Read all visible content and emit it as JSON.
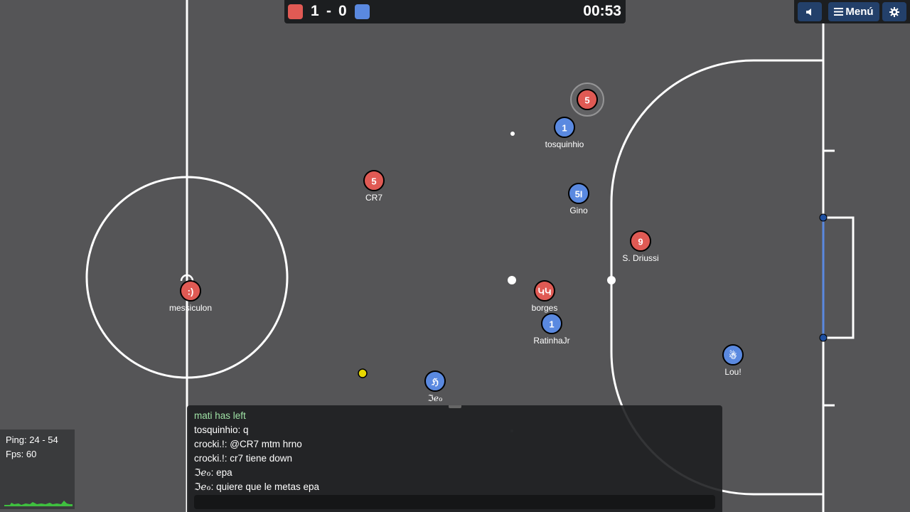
{
  "scoreboard": {
    "red_score": "1",
    "separator": "-",
    "blue_score": "0",
    "time": "00:53",
    "red_color": "#e05a54",
    "blue_color": "#5a89e0"
  },
  "controls": {
    "sound_icon": "speaker-icon",
    "menu_label": "Menú",
    "menu_icon": "hamburger-icon",
    "settings_icon": "gear-icon"
  },
  "players": [
    {
      "team": "red",
      "avatar": "5",
      "name": ""
    },
    {
      "team": "blue",
      "avatar": "1",
      "name": "tosquinhio"
    },
    {
      "team": "red",
      "avatar": "5",
      "name": "CR7"
    },
    {
      "team": "blue",
      "avatar": "5I",
      "name": "Gino"
    },
    {
      "team": "red",
      "avatar": "9",
      "name": "S. Driussi"
    },
    {
      "team": "red",
      "avatar": ":)",
      "name": "messiculon"
    },
    {
      "team": "red",
      "avatar": "ԿԿ",
      "name": "borges"
    },
    {
      "team": "blue",
      "avatar": "1",
      "name": "RatinhaJr"
    },
    {
      "team": "blue",
      "avatar": "☃",
      "name": "Lou!"
    },
    {
      "team": "blue",
      "avatar": "ℌ",
      "name": "ℑℯℴ"
    }
  ],
  "stats": {
    "ping": "Ping: 24 - 54",
    "fps": "Fps: 60"
  },
  "chat": {
    "messages": [
      {
        "text": "mati has left",
        "type": "notice"
      },
      {
        "text": "tosquinhio: q",
        "type": "message"
      },
      {
        "text": "crocki.!: @CR7 mtm hrno",
        "type": "message"
      },
      {
        "text": "crocki.!: cr7 tiene down",
        "type": "message"
      },
      {
        "text": "ℑℯℴ: epa",
        "type": "message"
      },
      {
        "text": "ℑℯℴ: quiere que le metas epa",
        "type": "message"
      }
    ],
    "input_value": ""
  }
}
